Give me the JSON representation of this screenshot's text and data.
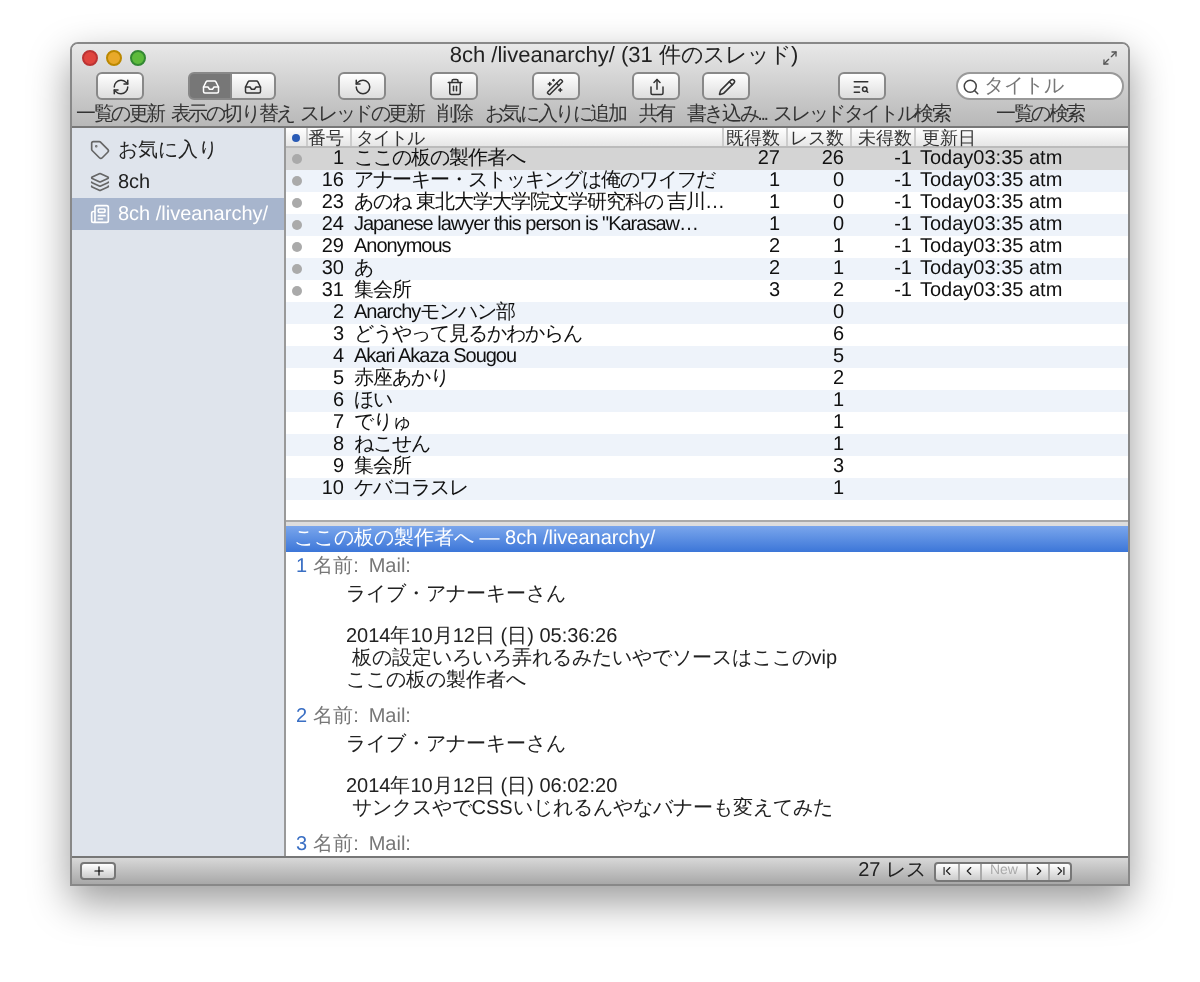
{
  "window": {
    "title": "8ch /liveanarchy/ (31 件のスレッド)"
  },
  "toolbar": {
    "items": [
      {
        "kind": "button",
        "label": "一覧の更新"
      },
      {
        "kind": "segmented",
        "label": "表示の切り替え",
        "segments": [
          {
            "selected": true
          },
          {
            "selected": false
          }
        ]
      },
      {
        "kind": "button",
        "label": "スレッドの更新"
      },
      {
        "kind": "button",
        "label": "削除"
      },
      {
        "kind": "button",
        "label": "お気に入りに追加"
      },
      {
        "kind": "button",
        "label": "共有"
      },
      {
        "kind": "button",
        "label": "書き込み..."
      },
      {
        "kind": "button",
        "label": "スレッドタイトル検索"
      },
      {
        "kind": "search",
        "placeholder": "タイトル",
        "label": "一覧の検索"
      }
    ]
  },
  "sidebar": {
    "items": [
      {
        "label": "お気に入り",
        "selected": false
      },
      {
        "label": "8ch",
        "selected": false
      },
      {
        "label": "8ch /liveanarchy/",
        "selected": true
      }
    ]
  },
  "threads": {
    "columns": [
      "番号",
      "タイトル",
      "既得数",
      "レス数",
      "未得数",
      "更新日"
    ],
    "rows": [
      {
        "has_log": true,
        "selected": true,
        "number": "1",
        "title": "ここの板の製作者へ",
        "fetched": "27",
        "replies": "26",
        "unread": "-1",
        "updated": "Today03:35 atm"
      },
      {
        "has_log": true,
        "selected": false,
        "number": "16",
        "title": "アナーキー・ストッキングは俺のワイフだ",
        "fetched": "1",
        "replies": "0",
        "unread": "-1",
        "updated": "Today03:35 atm"
      },
      {
        "has_log": true,
        "selected": false,
        "number": "23",
        "title": "あのね 東北大学大学院文学研究科の 吉川…",
        "fetched": "1",
        "replies": "0",
        "unread": "-1",
        "updated": "Today03:35 atm"
      },
      {
        "has_log": true,
        "selected": false,
        "number": "24",
        "title": "Japanese lawyer this person is \"Karasaw…",
        "fetched": "1",
        "replies": "0",
        "unread": "-1",
        "updated": "Today03:35 atm"
      },
      {
        "has_log": true,
        "selected": false,
        "number": "29",
        "title": "Anonymous",
        "fetched": "2",
        "replies": "1",
        "unread": "-1",
        "updated": "Today03:35 atm"
      },
      {
        "has_log": true,
        "selected": false,
        "number": "30",
        "title": "あ",
        "fetched": "2",
        "replies": "1",
        "unread": "-1",
        "updated": "Today03:35 atm"
      },
      {
        "has_log": true,
        "selected": false,
        "number": "31",
        "title": "集会所",
        "fetched": "3",
        "replies": "2",
        "unread": "-1",
        "updated": "Today03:35 atm"
      },
      {
        "has_log": false,
        "selected": false,
        "number": "2",
        "title": "Anarchyモンハン部",
        "replies": "0"
      },
      {
        "has_log": false,
        "selected": false,
        "number": "3",
        "title": "どうやって見るかわからん",
        "replies": "6"
      },
      {
        "has_log": false,
        "selected": false,
        "number": "4",
        "title": "Akari Akaza Sougou",
        "replies": "5"
      },
      {
        "has_log": false,
        "selected": false,
        "number": "5",
        "title": "赤座あかり",
        "replies": "2"
      },
      {
        "has_log": false,
        "selected": false,
        "number": "6",
        "title": "ほい",
        "replies": "1"
      },
      {
        "has_log": false,
        "selected": false,
        "number": "7",
        "title": "でりゅ",
        "replies": "1"
      },
      {
        "has_log": false,
        "selected": false,
        "number": "8",
        "title": "ねこせん",
        "replies": "1"
      },
      {
        "has_log": false,
        "selected": false,
        "number": "9",
        "title": "集会所",
        "replies": "3"
      },
      {
        "has_log": false,
        "selected": false,
        "number": "10",
        "title": "ケバコラスレ",
        "replies": "1"
      }
    ]
  },
  "thread_view": {
    "title": "ここの板の製作者へ — 8ch /liveanarchy/",
    "posts": [
      {
        "number": "1",
        "name_label": "名前:",
        "mail_label": "Mail:",
        "name": "ライブ・アナーキーさん",
        "date": "2014年10月12日 (日) 05:36:26",
        "body": [
          " 板の設定いろいろ弄れるみたいやでソースはここのvip",
          "ここの板の製作者へ"
        ]
      },
      {
        "number": "2",
        "name_label": "名前:",
        "mail_label": "Mail:",
        "name": "ライブ・アナーキーさん",
        "date": "2014年10月12日 (日) 06:02:20",
        "body": [
          " サンクスやでCSSいじれるんやなバナーも変えてみた"
        ]
      },
      {
        "number": "3",
        "name_label": "名前:",
        "mail_label": "Mail:"
      }
    ]
  },
  "status_bar": {
    "count": "27 レス",
    "nav": [
      {
        "kind": "first",
        "disabled": false
      },
      {
        "kind": "prev",
        "disabled": false
      },
      {
        "kind": "new",
        "label": "New",
        "disabled": true
      },
      {
        "kind": "next",
        "disabled": false
      },
      {
        "kind": "last",
        "disabled": false
      }
    ]
  }
}
